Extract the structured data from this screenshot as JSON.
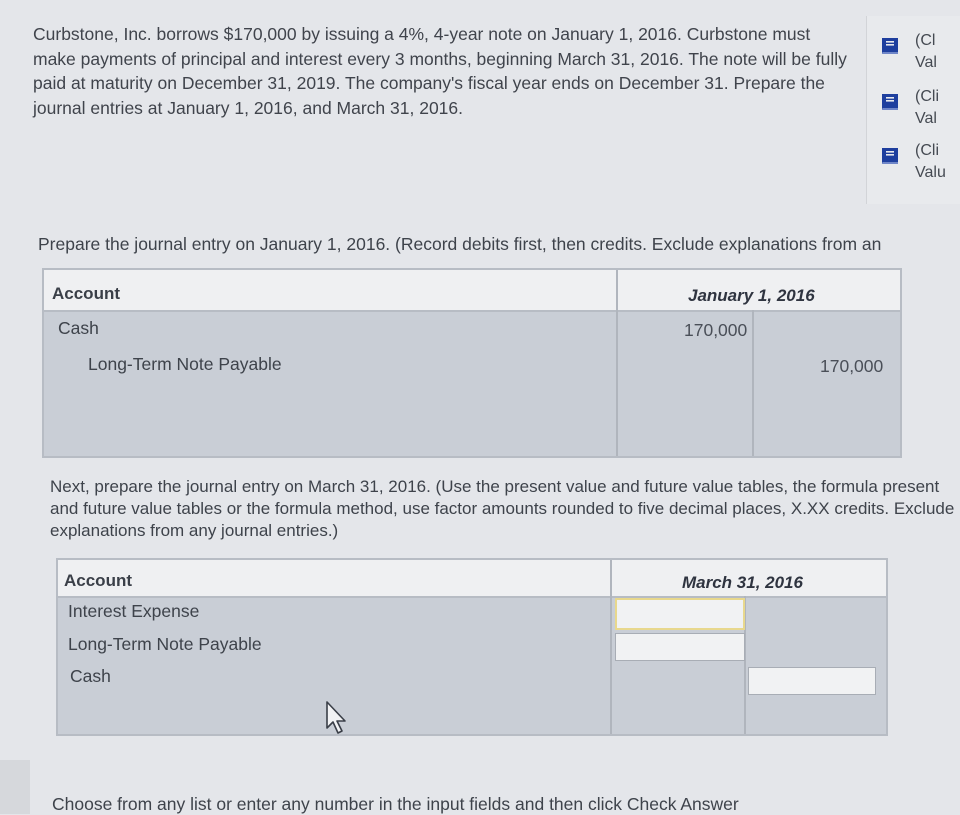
{
  "problem": {
    "text": "Curbstone, Inc. borrows $170,000 by issuing a 4%, 4-year note on January 1, 2016. Curbstone must make payments of principal and interest every 3 months, beginning March 31, 2016. The note will be fully paid at maturity on December 31, 2019. The company's fiscal year ends on December 31. Prepare the journal entries at January 1, 2016, and March 31, 2016."
  },
  "side_links": [
    {
      "icon": "book-icon",
      "line1": "(Cl",
      "line2": "Val"
    },
    {
      "icon": "book-icon",
      "line1": "(Cli",
      "line2": "Val"
    },
    {
      "icon": "book-icon",
      "line1": "(Cli",
      "line2": "Valu"
    }
  ],
  "entry1": {
    "instruction": "Prepare the journal entry on January 1, 2016. (Record debits first, then credits. Exclude explanations from an",
    "header_account": "Account",
    "header_date": "January 1, 2016",
    "rows": [
      {
        "account": "Cash",
        "debit": "170,000",
        "credit": ""
      },
      {
        "account": "Long-Term Note Payable",
        "debit": "",
        "credit": "170,000"
      }
    ]
  },
  "entry2": {
    "instruction": "Next, prepare the journal entry on March 31, 2016. (Use the present value and future value tables, the formula present and future value tables or the formula method, use factor amounts rounded to five decimal places, X.XX credits. Exclude explanations from any journal entries.)",
    "header_account": "Account",
    "header_date": "March 31, 2016",
    "rows": [
      {
        "account": "Interest Expense",
        "debit": "",
        "credit": ""
      },
      {
        "account": "Long-Term Note Payable",
        "debit": "",
        "credit": ""
      },
      {
        "account": "Cash",
        "debit": "",
        "credit": ""
      }
    ]
  },
  "footer": {
    "text": "Choose from any list or enter any number in the input fields and then click Check Answer"
  },
  "colors": {
    "background": "#e4e6ea",
    "table_body": "#c9ced6",
    "icon_blue": "#1e3f9e",
    "active_input_border": "#e8d88d"
  }
}
